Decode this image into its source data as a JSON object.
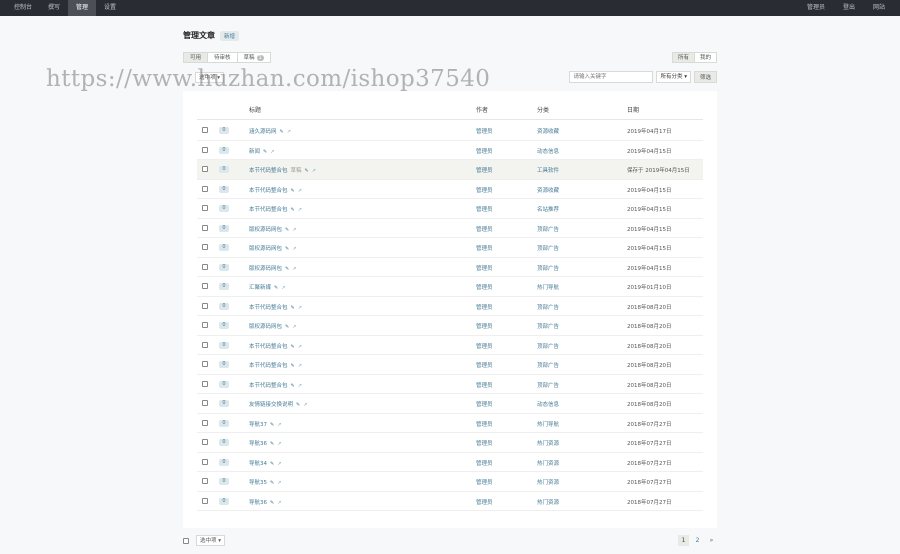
{
  "topbar": {
    "left": [
      {
        "label": "控制台",
        "active": false
      },
      {
        "label": "撰写",
        "active": false
      },
      {
        "label": "管理",
        "active": true
      },
      {
        "label": "设置",
        "active": false
      }
    ],
    "right": [
      {
        "label": "管理员"
      },
      {
        "label": "登出"
      },
      {
        "label": "网站"
      }
    ]
  },
  "header": {
    "title": "管理文章",
    "new_label": "新增"
  },
  "filters": {
    "tabs": [
      {
        "label": "可用",
        "active": true
      },
      {
        "label": "待审核",
        "active": false
      },
      {
        "label": "草稿",
        "active": false,
        "count": "1"
      }
    ],
    "owner": [
      {
        "label": "所有",
        "active": true
      },
      {
        "label": "我的",
        "active": false
      }
    ],
    "select_label": "选中项",
    "search_placeholder": "请输入关键字",
    "category_select": "所有分类",
    "filter_button": "筛选"
  },
  "table": {
    "headers": {
      "title": "标题",
      "author": "作者",
      "category": "分类",
      "date": "日期"
    },
    "rows": [
      {
        "comments": "0",
        "title": "涵久源码网",
        "draft": "",
        "author": "管理员",
        "category": "资源收藏",
        "date": "2019年04月17日",
        "hover": false
      },
      {
        "comments": "0",
        "title": "新闻",
        "draft": "",
        "author": "管理员",
        "category": "动态信息",
        "date": "2019年04月15日",
        "hover": false
      },
      {
        "comments": "0",
        "title": "本节代码整合包",
        "draft": "草稿",
        "author": "管理员",
        "category": "工具软件",
        "date": "保存于 2019年04月15日",
        "hover": true
      },
      {
        "comments": "0",
        "title": "本节代码整合包",
        "draft": "",
        "author": "管理员",
        "category": "资源收藏",
        "date": "2019年04月15日",
        "hover": false
      },
      {
        "comments": "0",
        "title": "本节代码整合包",
        "draft": "",
        "author": "管理员",
        "category": "名站推荐",
        "date": "2019年04月15日",
        "hover": false
      },
      {
        "comments": "0",
        "title": "版权源码网包",
        "draft": "",
        "author": "管理员",
        "category": "顶部广告",
        "date": "2019年04月15日",
        "hover": false
      },
      {
        "comments": "0",
        "title": "版权源码网包",
        "draft": "",
        "author": "管理员",
        "category": "顶部广告",
        "date": "2019年04月15日",
        "hover": false
      },
      {
        "comments": "0",
        "title": "版权源码网包",
        "draft": "",
        "author": "管理员",
        "category": "顶部广告",
        "date": "2019年04月15日",
        "hover": false
      },
      {
        "comments": "0",
        "title": "汇聚新媒",
        "draft": "",
        "author": "管理员",
        "category": "热门导航",
        "date": "2019年01月10日",
        "hover": false
      },
      {
        "comments": "0",
        "title": "本节代码整合包",
        "draft": "",
        "author": "管理员",
        "category": "顶部广告",
        "date": "2018年08月20日",
        "hover": false
      },
      {
        "comments": "0",
        "title": "版权源码网包",
        "draft": "",
        "author": "管理员",
        "category": "顶部广告",
        "date": "2018年08月20日",
        "hover": false
      },
      {
        "comments": "0",
        "title": "本节代码整合包",
        "draft": "",
        "author": "管理员",
        "category": "顶部广告",
        "date": "2018年08月20日",
        "hover": false
      },
      {
        "comments": "0",
        "title": "本节代码整合包",
        "draft": "",
        "author": "管理员",
        "category": "顶部广告",
        "date": "2018年08月20日",
        "hover": false
      },
      {
        "comments": "0",
        "title": "本节代码整合包",
        "draft": "",
        "author": "管理员",
        "category": "顶部广告",
        "date": "2018年08月20日",
        "hover": false
      },
      {
        "comments": "0",
        "title": "友情链接交换说明",
        "draft": "",
        "author": "管理员",
        "category": "动态信息",
        "date": "2018年08月20日",
        "hover": false
      },
      {
        "comments": "0",
        "title": "导航37",
        "draft": "",
        "author": "管理员",
        "category": "热门导航",
        "date": "2018年07月27日",
        "hover": false
      },
      {
        "comments": "0",
        "title": "导航36",
        "draft": "",
        "author": "管理员",
        "category": "热门资源",
        "date": "2018年07月27日",
        "hover": false
      },
      {
        "comments": "0",
        "title": "导航34",
        "draft": "",
        "author": "管理员",
        "category": "热门资源",
        "date": "2018年07月27日",
        "hover": false
      },
      {
        "comments": "0",
        "title": "导航35",
        "draft": "",
        "author": "管理员",
        "category": "热门资源",
        "date": "2018年07月27日",
        "hover": false
      },
      {
        "comments": "0",
        "title": "导航36",
        "draft": "",
        "author": "管理员",
        "category": "热门资源",
        "date": "2018年07月27日",
        "hover": false
      }
    ]
  },
  "footer": {
    "select_label": "选中项",
    "pages": [
      {
        "label": "1",
        "current": true
      },
      {
        "label": "2",
        "current": false
      },
      {
        "label": "»",
        "current": false
      }
    ]
  },
  "watermark": "https://www.huzhan.com/ishop37540",
  "icons": {
    "edit": "pencil-icon",
    "view": "external-link-icon",
    "dropdown": "caret-down-icon"
  },
  "colors": {
    "topbar": "#292d33",
    "link": "#467b96",
    "background": "#f6f8f9"
  }
}
